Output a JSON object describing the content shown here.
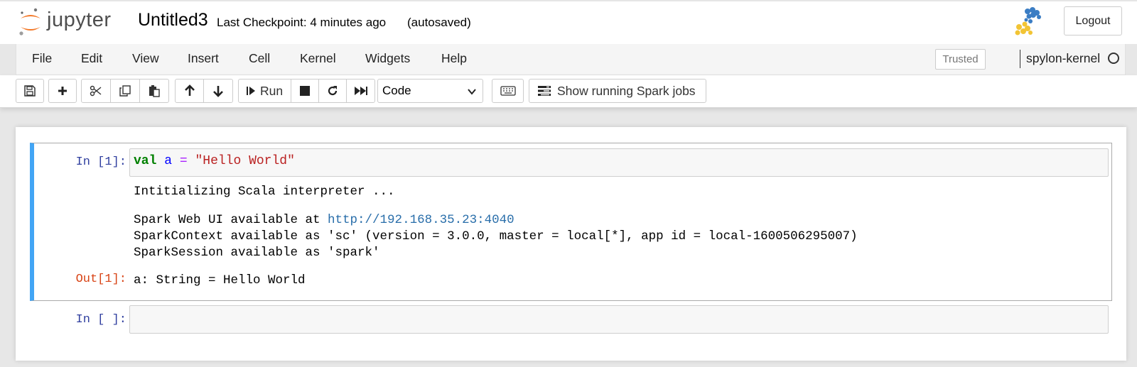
{
  "header": {
    "logo_text": "jupyter",
    "notebook_name": "Untitled3",
    "checkpoint": "Last Checkpoint: 4 minutes ago",
    "autosave": "(autosaved)",
    "logout_label": "Logout"
  },
  "menubar": {
    "items": [
      "File",
      "Edit",
      "View",
      "Insert",
      "Cell",
      "Kernel",
      "Widgets",
      "Help"
    ],
    "trusted_label": "Trusted",
    "kernel_name": "spylon-kernel"
  },
  "toolbar": {
    "run_label": "Run",
    "cell_type": "Code",
    "spark_jobs_label": "Show running Spark jobs",
    "icons": [
      "save-icon",
      "plus-icon",
      "scissors-icon",
      "copy-icon",
      "paste-icon",
      "arrow-up-icon",
      "arrow-down-icon",
      "step-forward-icon",
      "stop-icon",
      "restart-icon",
      "fast-forward-icon",
      "keyboard-icon",
      "tasks-icon"
    ]
  },
  "cells": [
    {
      "prompt_in": "In [1]:",
      "code": {
        "keyword": "val",
        "var": "a",
        "op": "=",
        "string": "\"Hello World\""
      },
      "stdout_line1": "Intitializing Scala interpreter ...",
      "stdout_line2_prefix": "Spark Web UI available at ",
      "stdout_link": "http://192.168.35.23:4040",
      "stdout_line3": "SparkContext available as 'sc' (version = 3.0.0, master = local[*], app id = local-1600506295007)",
      "stdout_line4": "SparkSession available as 'spark'",
      "prompt_out": "Out[1]:",
      "result": "a: String = Hello World"
    },
    {
      "prompt_in": "In [ ]:",
      "code_value": ""
    }
  ],
  "colors": {
    "selected_cell_bar": "#42a5f5",
    "prompt_in": "#303f9f",
    "prompt_out": "#d84315",
    "jupyter_orange": "#f37726"
  }
}
